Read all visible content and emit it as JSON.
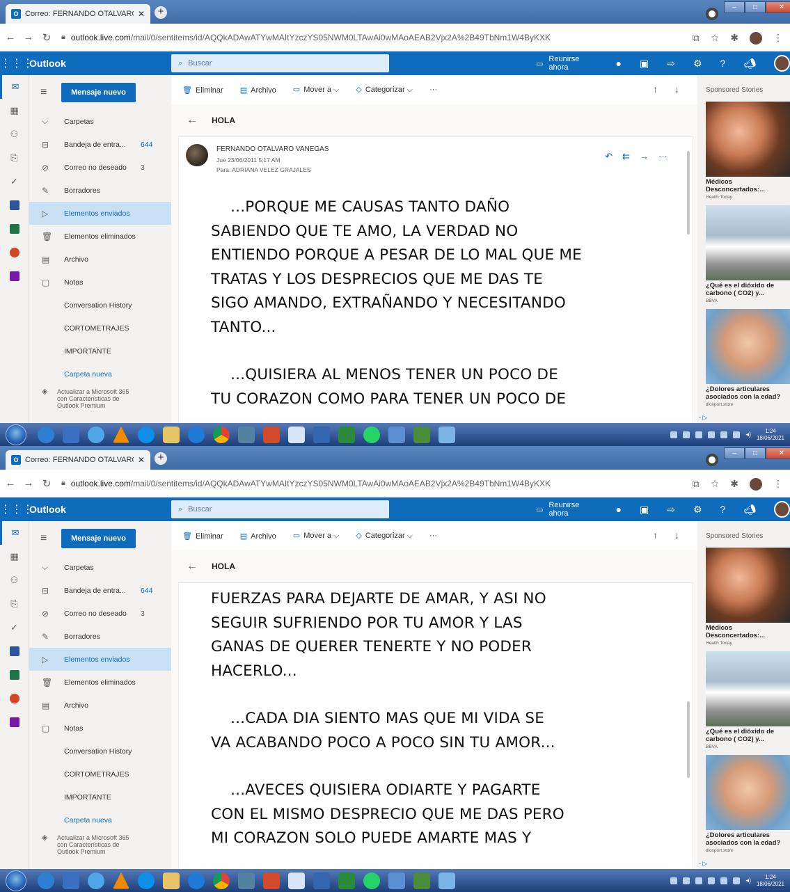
{
  "browser": {
    "tab_title": "Correo: FERNANDO OTALVARO",
    "tab_close": "✕",
    "new_tab": "+",
    "url_host": "outlook.live.com",
    "url_path": "/mail/0/sentitems/id/AQQkADAwATYwMAItYzczYS05NWM0LTAwAi0wMAoAEAB2Vjx2A%2B49TbNm1W4ByKXK"
  },
  "outlook": {
    "brand": "Outlook",
    "search_placeholder": "Buscar",
    "meet_now": "Reunirse ahora",
    "new_message": "Mensaje nuevo",
    "folders": [
      {
        "label": "Carpetas",
        "icon": "chevron-down-icon",
        "count": ""
      },
      {
        "label": "Bandeja de entra...",
        "icon": "inbox-icon",
        "count": "644"
      },
      {
        "label": "Correo no deseado",
        "icon": "junk-icon",
        "count": "3"
      },
      {
        "label": "Borradores",
        "icon": "pencil-icon",
        "count": ""
      },
      {
        "label": "Elementos enviados",
        "icon": "send-icon",
        "count": ""
      },
      {
        "label": "Elementos eliminados",
        "icon": "trash-icon",
        "count": ""
      },
      {
        "label": "Archivo",
        "icon": "archive-icon",
        "count": ""
      },
      {
        "label": "Notas",
        "icon": "note-icon",
        "count": ""
      }
    ],
    "sub_folders": [
      "Conversation History",
      "CORTOMETRAJES",
      "IMPORTANTE"
    ],
    "new_folder": "Carpeta nueva",
    "upsell_line1": "Actualizar a Microsoft 365",
    "upsell_line2": "con Características de",
    "upsell_line3": "Outlook Premium",
    "commands": {
      "delete": "Eliminar",
      "archive": "Archivo",
      "move": "Mover a",
      "categorize": "Categorizar",
      "more": "···"
    },
    "subject": "HOLA",
    "sender": "FERNANDO OTALVARO VANEGAS",
    "date": "Jue 23/06/2011 5:17 AM",
    "to_label": "Para:",
    "to": "ADRIANA VELEZ GRAJALES",
    "body_1": [
      "    ...PORQUE ME CAUSAS TANTO DAÑO",
      "SABIENDO QUE TE AMO, LA VERDAD NO",
      "ENTIENDO PORQUE A PESAR DE LO MAL QUE ME",
      "TRATAS Y LOS DESPRECIOS QUE ME DAS TE",
      "SIGO AMANDO, EXTRAÑANDO Y NECESITANDO",
      "TANTO...",
      "",
      "    ...QUISIERA AL MENOS TENER UN POCO DE",
      "TU CORAZON COMO PARA TENER UN POCO DE"
    ],
    "body_2": [
      "FUERZAS PARA DEJARTE DE AMAR, Y ASI NO",
      "SEGUIR SUFRIENDO POR TU AMOR Y LAS",
      "GANAS DE QUERER TENERTE Y NO PODER",
      "HACERLO...",
      "",
      "    ...CADA DIA SIENTO MAS QUE MI VIDA SE",
      "VA ACABANDO POCO A POCO SIN TU AMOR...",
      "",
      "    ...AVECES QUISIERA ODIARTE Y PAGARTE",
      "CON EL MISMO DESPRECIO QUE ME DAS PERO",
      "MI CORAZON SOLO PUEDE AMARTE MAS Y"
    ]
  },
  "ads": {
    "header": "Sponsored Stories",
    "items_1": [
      {
        "headline": "Médicos Desconcertados:...",
        "source": "Health Today"
      },
      {
        "headline": "¿Qué es el dióxido de carbono ( CO2) y...",
        "source": "BBVA"
      },
      {
        "headline": "¿Dolores articulares asociados con la edad?",
        "source": "dioxport.store"
      }
    ],
    "items_2": [
      {
        "headline": "Médicos Desconcertados:...",
        "source": "Health Today"
      },
      {
        "headline": "¿Qué es el dióxido de carbono ( CO2) y...",
        "source": "BBVA"
      },
      {
        "headline": "¿Dolores articulares asociados con la edad?",
        "source": "dioxport.store"
      }
    ]
  },
  "taskbar": {
    "time": "1:24",
    "date": "18/06/2021"
  },
  "colors": {
    "outlook_blue": "#0f6cbd",
    "selected_folder": "#c7e0f4"
  }
}
